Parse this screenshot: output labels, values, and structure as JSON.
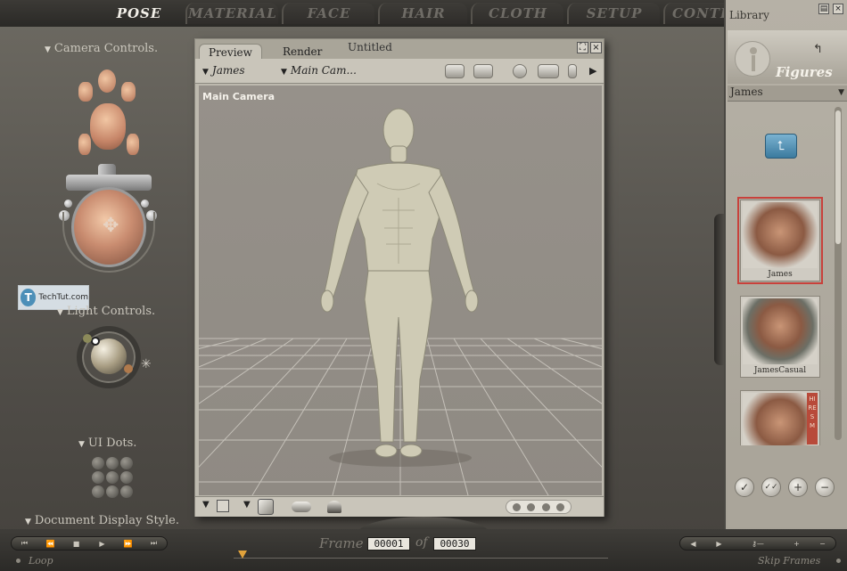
{
  "tabs": [
    {
      "label": "POSE",
      "active": true
    },
    {
      "label": "MATERIAL",
      "active": false
    },
    {
      "label": "FACE",
      "active": false
    },
    {
      "label": "HAIR",
      "active": false
    },
    {
      "label": "CLOTH",
      "active": false
    },
    {
      "label": "SETUP",
      "active": false
    },
    {
      "label": "CONTE",
      "active": false
    }
  ],
  "left": {
    "camera_controls": "Camera Controls.",
    "light_controls": "Light Controls.",
    "ui_dots": "UI Dots.",
    "document_display_style": "Document Display Style."
  },
  "watermark": {
    "letter": "T",
    "text": "TechTut.com"
  },
  "preview": {
    "tabs": [
      {
        "label": "Preview",
        "selected": true
      },
      {
        "label": "Render",
        "selected": false
      }
    ],
    "title": "Untitled",
    "figure_select": "James",
    "camera_select": "Main Cam...",
    "viewport_label": "Main Camera",
    "maximize_glyph": "⛶",
    "close_glyph": "×"
  },
  "library": {
    "title": "Library",
    "header": "Figures",
    "dropdown": "James",
    "items": [
      {
        "name": "James",
        "selected": true
      },
      {
        "name": "JamesCasual",
        "selected": false
      }
    ],
    "hires_tag": "HI RES M",
    "action_glyphs": [
      "✓",
      "✓✓",
      "+",
      "−"
    ]
  },
  "timeline": {
    "frame_label": "Frame",
    "current_frame": "00001",
    "of_label": "of",
    "total_frames": "00030",
    "loop_label": "Loop",
    "skip_label": "Skip Frames"
  },
  "colors": {
    "accent_selected": "#c8413b",
    "folder": "#3b7a9e",
    "scrub_marker": "#e0a23b"
  }
}
